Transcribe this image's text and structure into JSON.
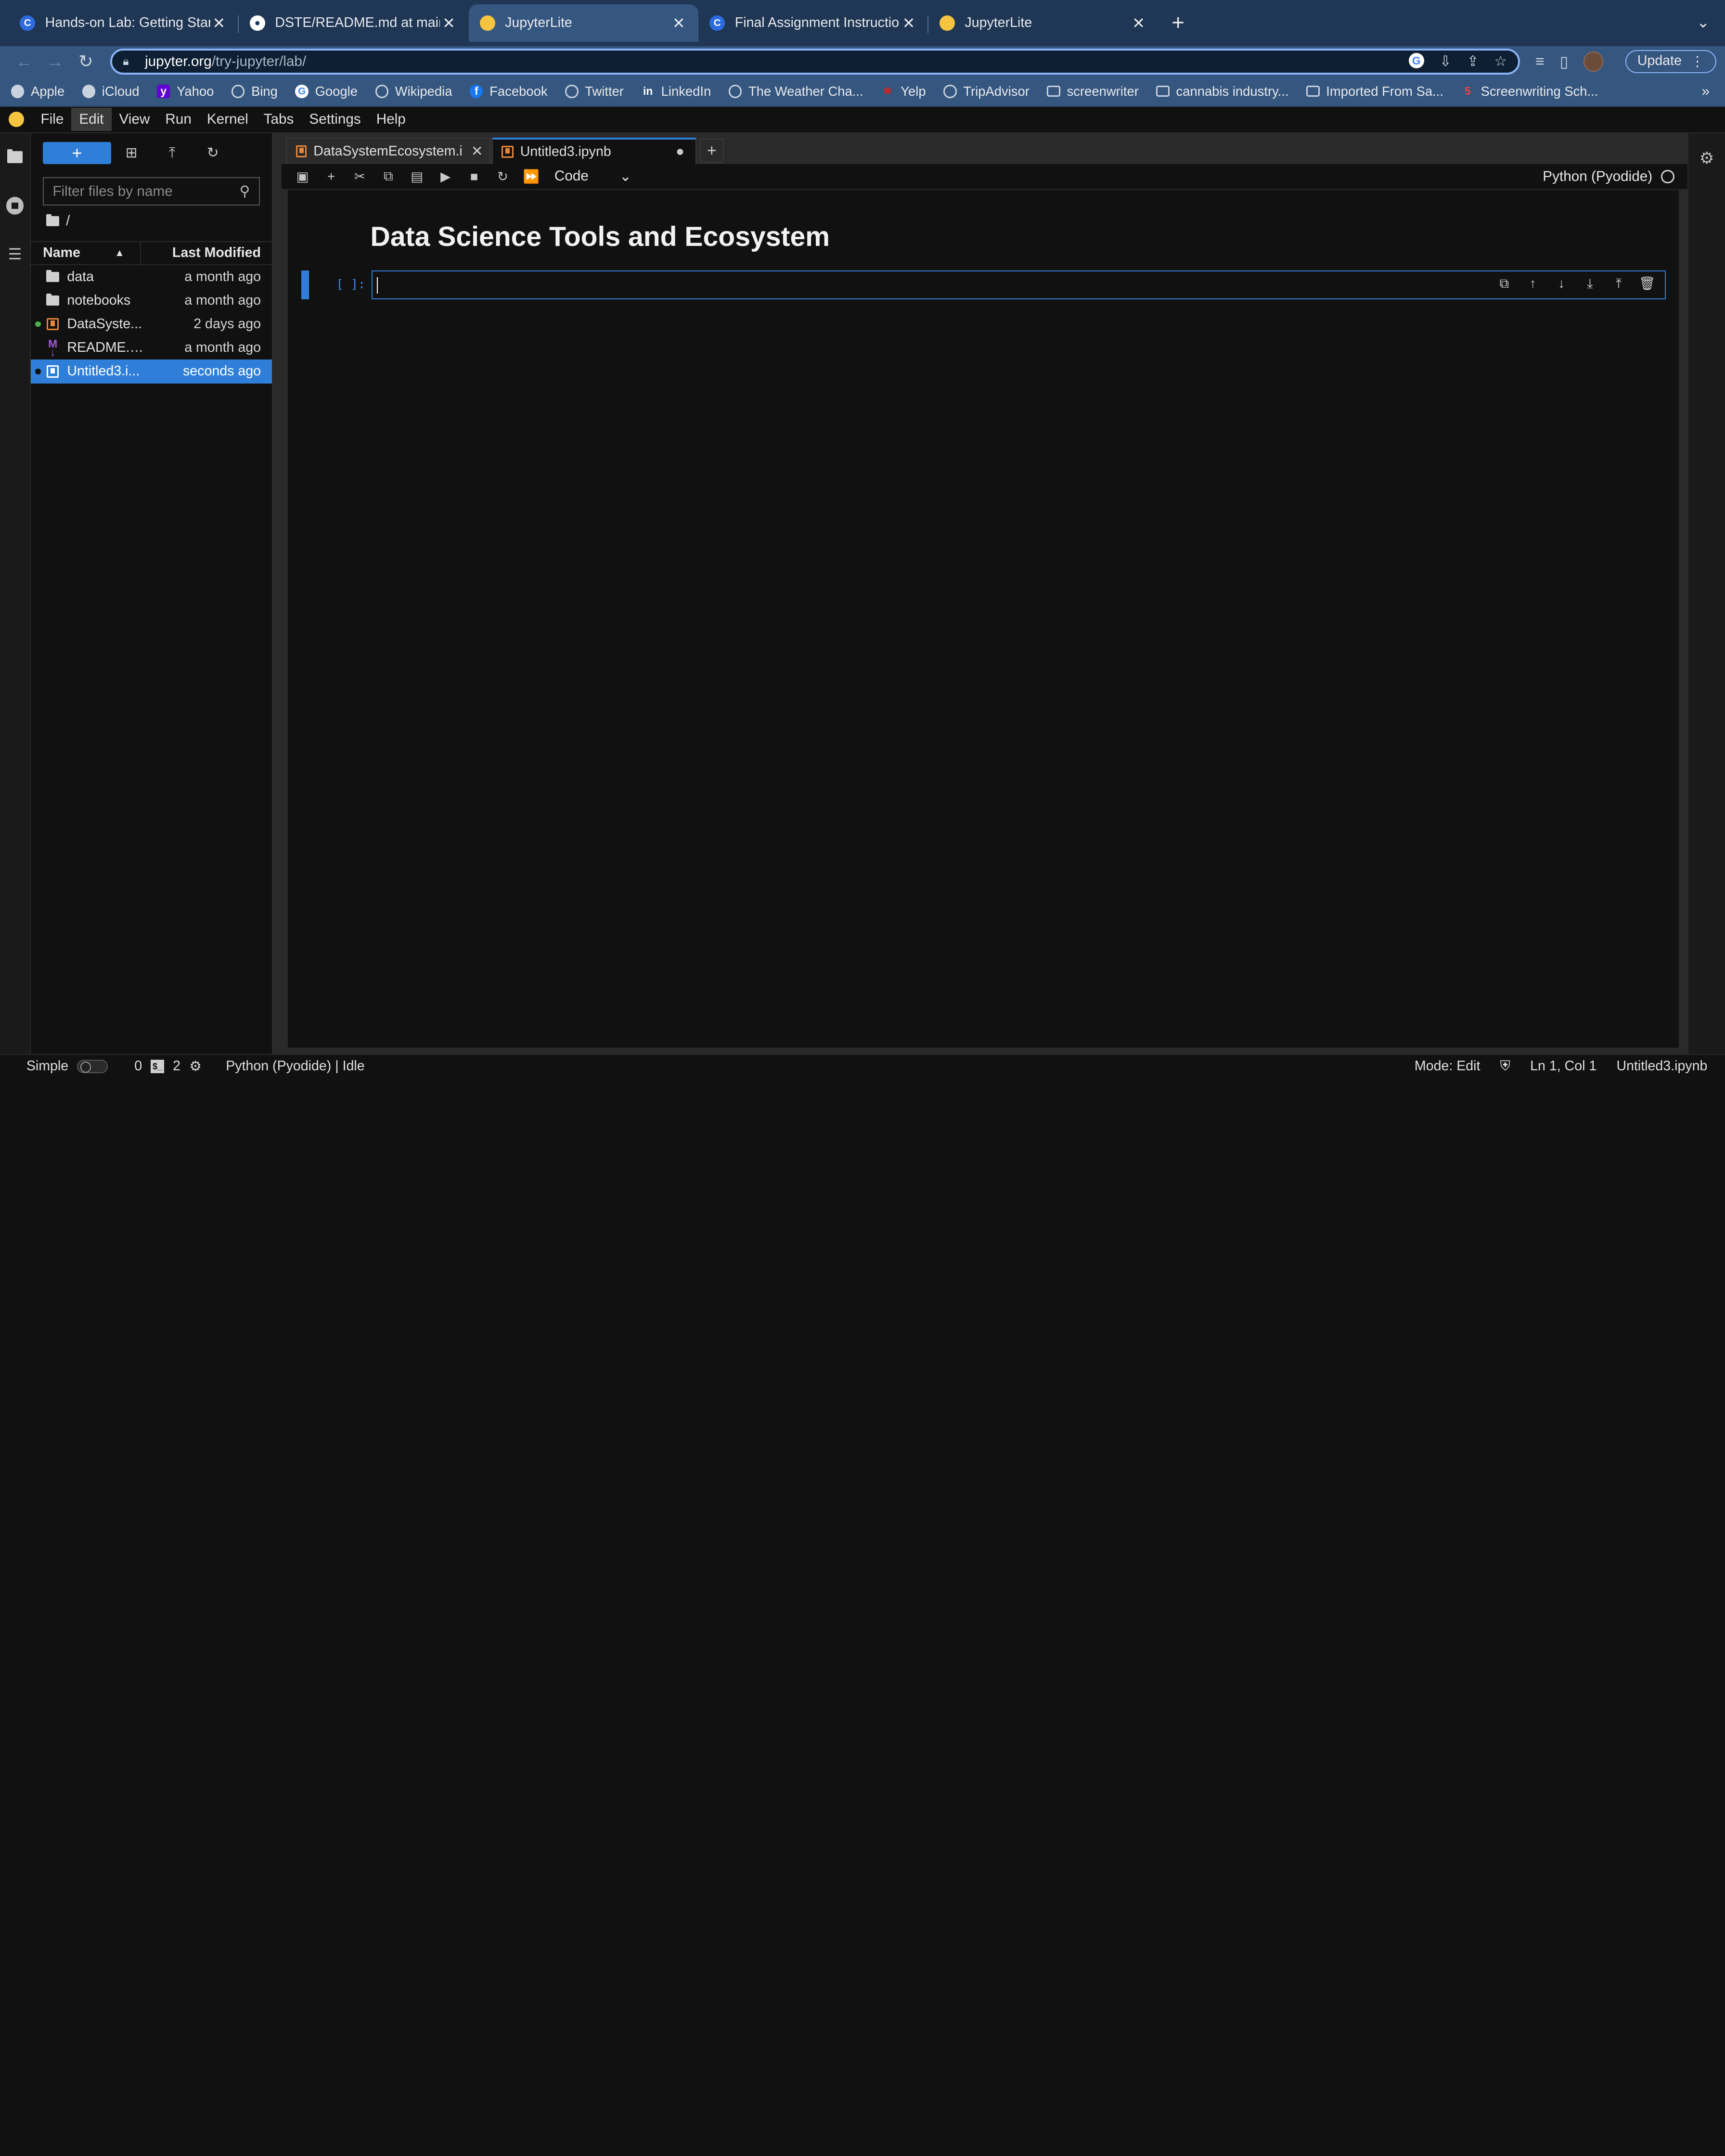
{
  "browser": {
    "tabs": [
      {
        "title": "Hands-on Lab: Getting Started",
        "favicon": "coursera-icon",
        "active": false
      },
      {
        "title": "DSTE/README.md at main · Kh",
        "favicon": "github-icon",
        "active": false
      },
      {
        "title": "JupyterLite",
        "favicon": "jupyter-icon",
        "active": true
      },
      {
        "title": "Final Assignment Instructions:",
        "favicon": "coursera-icon",
        "active": false
      },
      {
        "title": "JupyterLite",
        "favicon": "jupyter-icon",
        "active": false
      }
    ],
    "url_host": "jupyter.org",
    "url_path": "/try-jupyter/lab/",
    "update_label": "Update",
    "bookmarks": [
      {
        "label": "Apple",
        "icon": "apple-icon"
      },
      {
        "label": "iCloud",
        "icon": "apple-icon"
      },
      {
        "label": "Yahoo",
        "icon": "yahoo-icon"
      },
      {
        "label": "Bing",
        "icon": "globe-icon"
      },
      {
        "label": "Google",
        "icon": "google-icon"
      },
      {
        "label": "Wikipedia",
        "icon": "globe-icon"
      },
      {
        "label": "Facebook",
        "icon": "facebook-icon"
      },
      {
        "label": "Twitter",
        "icon": "globe-icon"
      },
      {
        "label": "LinkedIn",
        "icon": "linkedin-icon"
      },
      {
        "label": "The Weather Cha...",
        "icon": "globe-icon"
      },
      {
        "label": "Yelp",
        "icon": "yelp-icon"
      },
      {
        "label": "TripAdvisor",
        "icon": "globe-icon"
      },
      {
        "label": "screenwriter",
        "icon": "folder-icon"
      },
      {
        "label": "cannabis industry...",
        "icon": "folder-icon"
      },
      {
        "label": "Imported From Sa...",
        "icon": "folder-icon"
      },
      {
        "label": "Screenwriting Sch...",
        "icon": "bookmark-icon"
      }
    ]
  },
  "jupyter": {
    "menu": [
      "File",
      "Edit",
      "View",
      "Run",
      "Kernel",
      "Tabs",
      "Settings",
      "Help"
    ],
    "active_menu": "Edit",
    "filebrowser": {
      "filter_placeholder": "Filter files by name",
      "breadcrumb": "/",
      "col_name": "Name",
      "col_modified": "Last Modified",
      "files": [
        {
          "name": "data",
          "type": "folder",
          "modified": "a month ago",
          "running": false,
          "selected": false
        },
        {
          "name": "notebooks",
          "type": "folder",
          "modified": "a month ago",
          "running": false,
          "selected": false
        },
        {
          "name": "DataSyste...",
          "type": "notebook",
          "modified": "2 days ago",
          "running": true,
          "selected": false
        },
        {
          "name": "README.md",
          "type": "markdown",
          "modified": "a month ago",
          "running": false,
          "selected": false
        },
        {
          "name": "Untitled3.i...",
          "type": "notebook",
          "modified": "seconds ago",
          "running": true,
          "selected": true
        }
      ]
    },
    "doc_tabs": [
      {
        "title": "DataSystemEcosystem.ipyr",
        "active": false,
        "closable": true
      },
      {
        "title": "Untitled3.ipynb",
        "active": true,
        "dirty": true
      }
    ],
    "cell_type": "Code",
    "kernel": "Python (Pyodide)",
    "notebook": {
      "heading": "Data Science Tools and Ecosystem",
      "cell_prompt": "[ ]:"
    },
    "status": {
      "mode_label": "Simple",
      "terminals": "0",
      "kernels": "2",
      "kernel_status": "Python (Pyodide) | Idle",
      "mode": "Mode: Edit",
      "position": "Ln 1, Col 1",
      "filename": "Untitled3.ipynb"
    }
  },
  "colors": {
    "accent": "#2f7fd8",
    "tabstrip": "#1f3654",
    "toolbar": "#35567f"
  }
}
